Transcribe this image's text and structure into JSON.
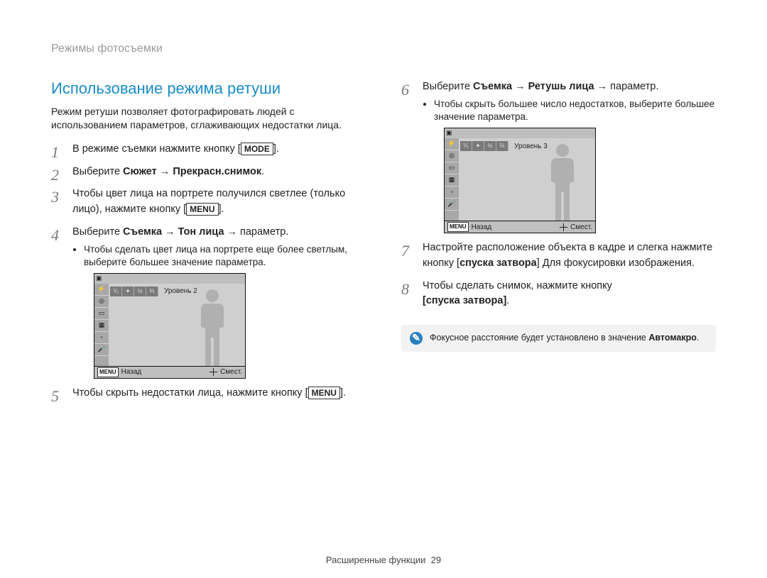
{
  "breadcrumb": "Режимы фотосъемки",
  "section_title": "Использование режима ретуши",
  "intro": "Режим ретуши позволяет фотографировать людей с использованием параметров, сглаживающих недостатки лица.",
  "buttons": {
    "mode": "MODE",
    "menu": "MENU"
  },
  "left_steps": {
    "s1_a": "В режиме съемки нажмите кнопку [",
    "s1_b": "].",
    "s2_a": "Выберите ",
    "s2_bold": "Сюжет → Прекрасн.снимок",
    "s2_b": ".",
    "s3_a": "Чтобы цвет лица на портрете получился светлее (только лицо), нажмите кнопку [",
    "s3_b": "].",
    "s4_a": "Выберите ",
    "s4_bold": "Съемка → Тон лица",
    "s4_b": " → параметр.",
    "s4_sub": "Чтобы сделать цвет лица на портрете еще более светлым, выберите большее значение параметра.",
    "s5_a": "Чтобы скрыть недостатки лица, нажмите кнопку [",
    "s5_b": "]."
  },
  "right_steps": {
    "s6_a": "Выберите ",
    "s6_bold": "Съемка → Ретушь лица",
    "s6_b": " → параметр.",
    "s6_sub": "Чтобы скрыть большее число недостатков, выберите большее значение параметра.",
    "s7_a": "Настройте расположение объекта в кадре и слегка нажмите кнопку [",
    "s7_bold": "спуска затвора",
    "s7_b": "] Для фокусировки изображения.",
    "s8_a": "Чтобы сделать снимок, нажмите кнопку ",
    "s8_bold": "[спуска затвора]",
    "s8_b": "."
  },
  "shot1": {
    "level_label": "Уровень 2",
    "cells": [
      "⅟₃",
      "✦",
      "½",
      "⅔"
    ],
    "back": "Назад",
    "set": "Смест."
  },
  "shot2": {
    "level_label": "Уровень 3",
    "cells": [
      "⅟₃",
      "✦",
      "½",
      "⅔"
    ],
    "back": "Назад",
    "set": "Смест."
  },
  "note_text_a": "Фокусное расстояние будет установлено в значение ",
  "note_text_bold": "Автомакро",
  "note_text_b": ".",
  "footer_label": "Расширенные функции",
  "footer_page": "29"
}
